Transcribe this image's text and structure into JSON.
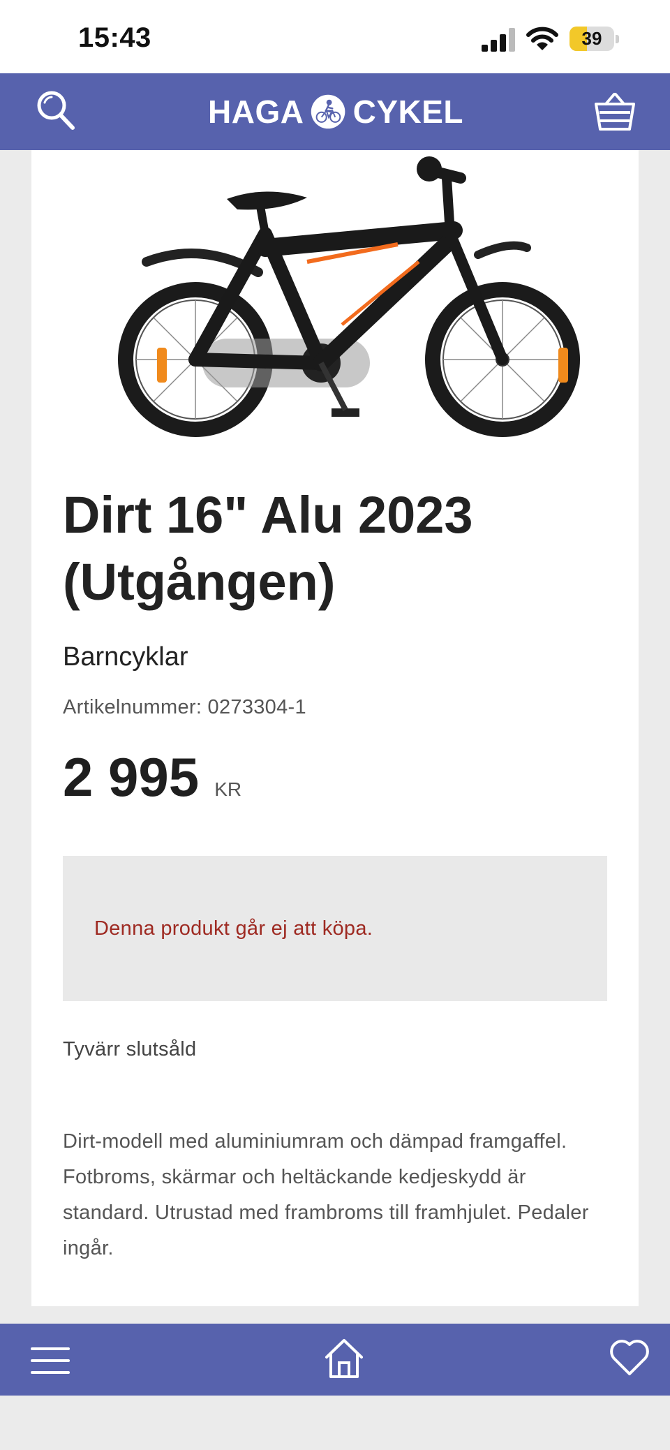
{
  "status_bar": {
    "time": "15:43",
    "battery_level": "39",
    "battery_percent": 39,
    "signal_icon": "cellular-signal-icon",
    "wifi_icon": "wifi-icon"
  },
  "header": {
    "logo_left": "HAGA",
    "logo_right": "CYKEL",
    "search_icon": "search-icon",
    "basket_icon": "basket-icon",
    "background_color": "#5762ad"
  },
  "product": {
    "image_icon": "bicycle-image",
    "title": "Dirt 16\" Alu 2023 (Utgången)",
    "category": "Barncyklar",
    "article_number": "Artikelnummer: 0273304-1",
    "price": "2 995",
    "currency": "KR",
    "notice": "Denna produkt går ej att köpa.",
    "soldout": "Tyvärr slutsåld",
    "description": "Dirt-modell med aluminiumram och dämpad framgaffel. Fotbroms, skärmar och heltäckande kedjeskydd är standard. Utrustad med frambroms till framhjulet. Pedaler ingår."
  },
  "bottom_nav": {
    "menu_icon": "hamburger-menu-icon",
    "home_icon": "home-icon",
    "favorites_icon": "heart-icon"
  },
  "colors": {
    "brand": "#5762ad",
    "notice_text": "#9e2a22",
    "notice_background": "#e9e9e9",
    "page_background": "#ebebeb"
  }
}
